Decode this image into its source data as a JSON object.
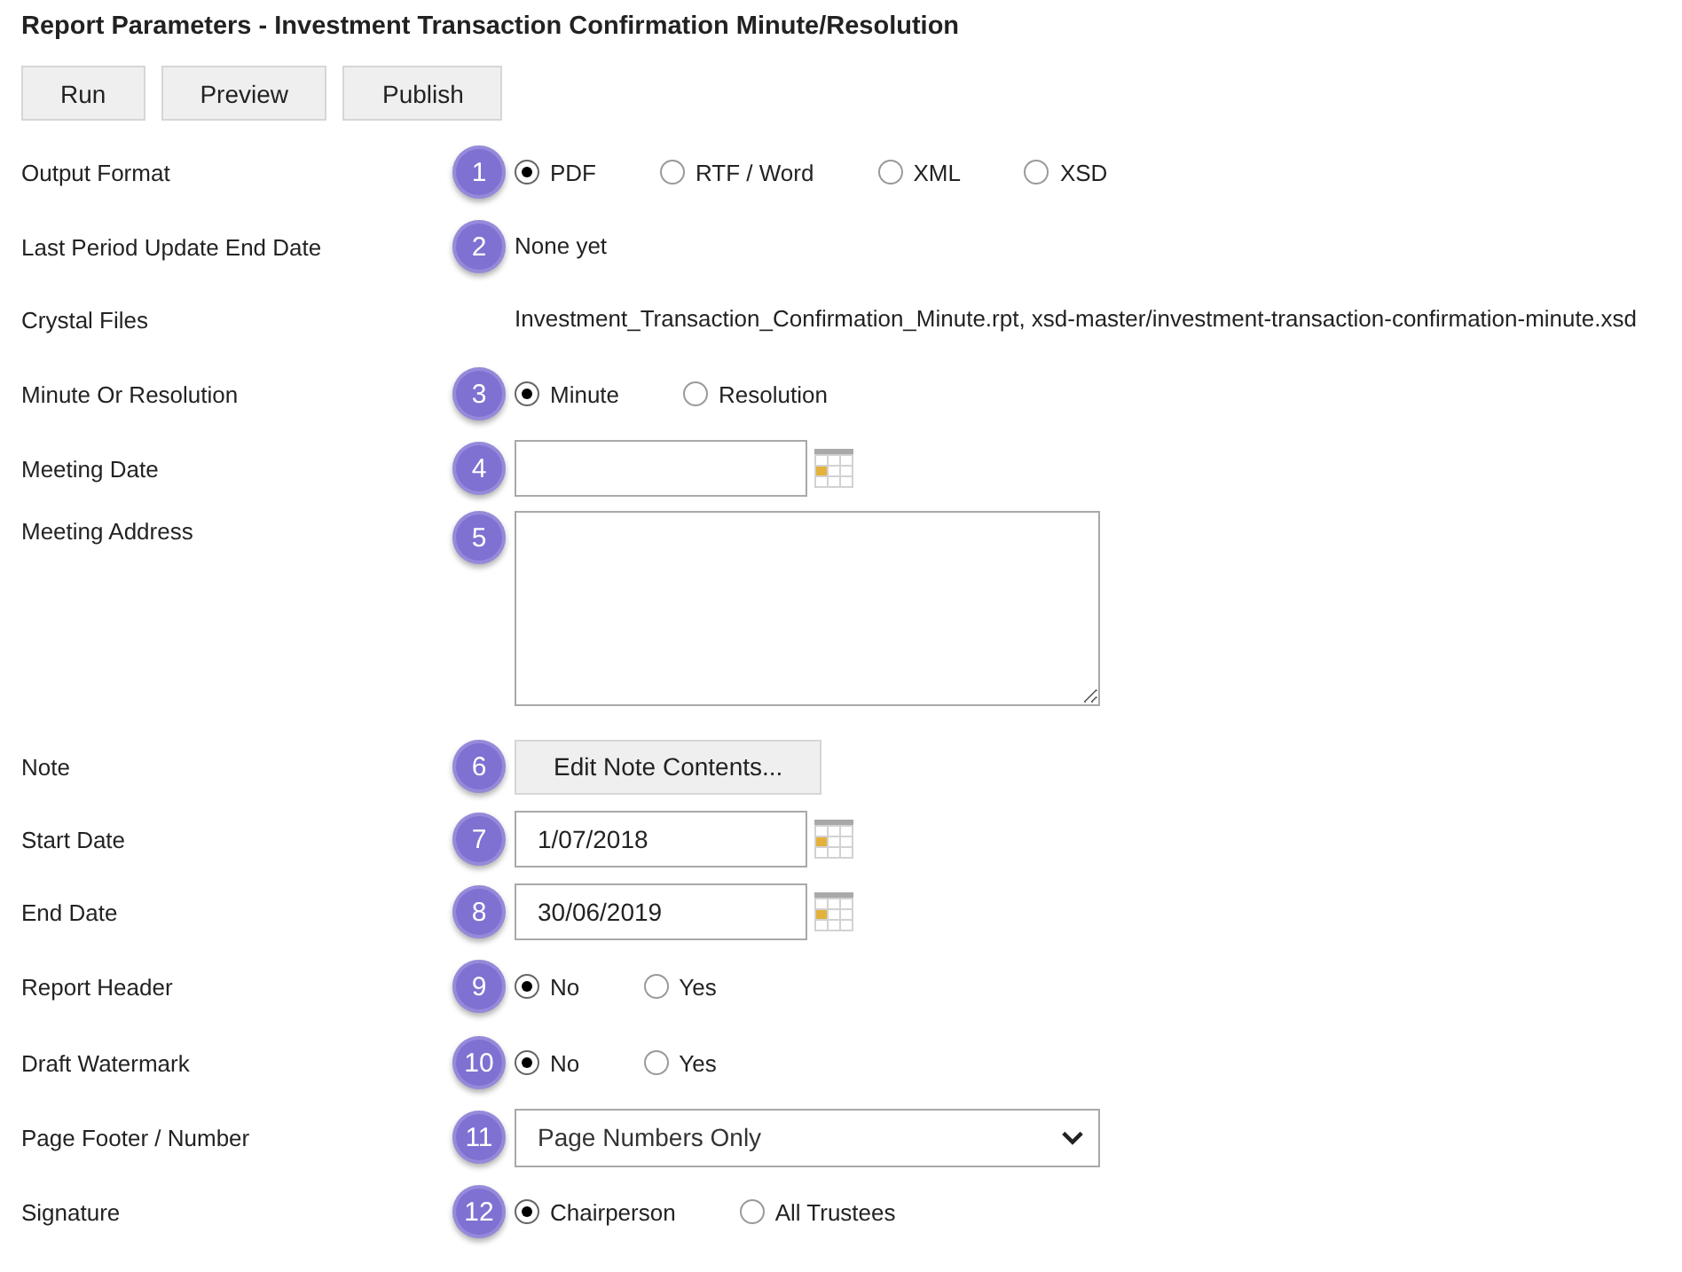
{
  "title": "Report Parameters - Investment Transaction Confirmation Minute/Resolution",
  "toolbar": [
    {
      "label": "Run"
    },
    {
      "label": "Preview"
    },
    {
      "label": "Publish"
    }
  ],
  "parameters": [
    {
      "label": "Output Format",
      "badge": "1",
      "kind": "radio",
      "options": [
        {
          "label": "PDF",
          "selected": true
        },
        {
          "label": "RTF / Word",
          "selected": false
        },
        {
          "label": "XML",
          "selected": false
        },
        {
          "label": "XSD",
          "selected": false
        }
      ]
    },
    {
      "label": "Last Period Update End Date",
      "badge": "2",
      "kind": "text",
      "value": "None yet"
    },
    {
      "label": "Crystal Files",
      "kind": "text",
      "value": "Investment_Transaction_Confirmation_Minute.rpt, xsd-master/investment-transaction-confirmation-minute.xsd"
    },
    {
      "label": "Minute Or Resolution",
      "badge": "3",
      "kind": "radio",
      "options": [
        {
          "label": "Minute",
          "selected": true
        },
        {
          "label": "Resolution",
          "selected": false
        }
      ]
    },
    {
      "label": "Meeting Date",
      "badge": "4",
      "kind": "date"
    },
    {
      "label": "Meeting Address",
      "badge": "5",
      "kind": "textarea"
    },
    {
      "label": "Note",
      "badge": "6",
      "kind": "button",
      "button": "Edit Note Contents..."
    },
    {
      "label": "Start Date",
      "badge": "7",
      "kind": "date",
      "value": "1/07/2018"
    },
    {
      "label": "End Date",
      "badge": "8",
      "kind": "date",
      "value": "30/06/2019"
    },
    {
      "label": "Report Header",
      "badge": "9",
      "kind": "radio",
      "options": [
        {
          "label": "No",
          "selected": true
        },
        {
          "label": "Yes",
          "selected": false
        }
      ]
    },
    {
      "label": "Draft Watermark",
      "badge": "10",
      "kind": "radio",
      "options": [
        {
          "label": "No",
          "selected": true
        },
        {
          "label": "Yes",
          "selected": false
        }
      ]
    },
    {
      "label": "Page Footer / Number",
      "badge": "11",
      "kind": "select",
      "value": "Page Numbers Only"
    },
    {
      "label": "Signature",
      "badge": "12",
      "kind": "radio",
      "options": [
        {
          "label": "Chairperson",
          "selected": true
        },
        {
          "label": "All Trustees",
          "selected": false
        }
      ]
    }
  ]
}
